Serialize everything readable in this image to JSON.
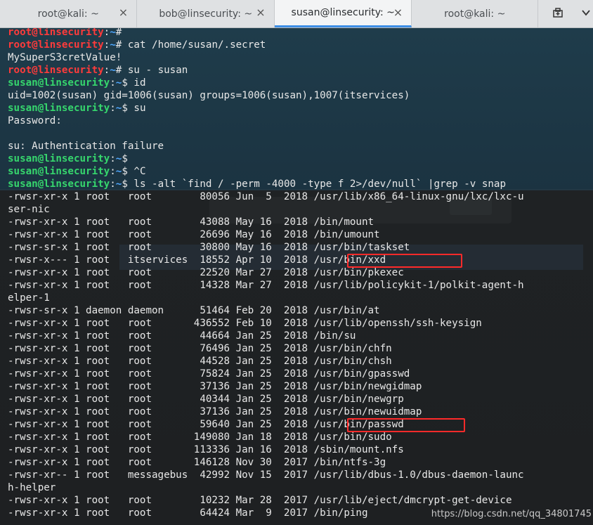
{
  "tabs": [
    {
      "label": "root@kali: ~",
      "active": false
    },
    {
      "label": "bob@linsecurity: ~",
      "active": false
    },
    {
      "label": "susan@linsecurity: ~",
      "active": true
    },
    {
      "label": "root@kali: ~",
      "active": false
    }
  ],
  "tab_actions": [
    {
      "name": "new-tab-icon",
      "glyph": "🖶"
    },
    {
      "name": "tabs-menu-icon",
      "glyph": "⌄"
    }
  ],
  "colors": {
    "accent": "#3d8ee6",
    "root_prompt": "#ff3b3b",
    "user_prompt": "#36d66d",
    "path": "#4fa8ff",
    "highlight": "#ff2a2a"
  },
  "terminal": {
    "prompt_lines": [
      {
        "user": "root@linsecurity",
        "path": "~",
        "symbol": "# ",
        "cmd": ""
      },
      {
        "user": "root@linsecurity",
        "path": "~",
        "symbol": "# ",
        "cmd": "cat /home/susan/.secret"
      },
      {
        "text": "MySuperS3cretValue!"
      },
      {
        "user": "root@linsecurity",
        "path": "~",
        "symbol": "# ",
        "cmd": "su - susan"
      },
      {
        "user": "susan@linsecurity",
        "path": "~",
        "symbol": "$ ",
        "cmd": "id"
      },
      {
        "text": "uid=1002(susan) gid=1006(susan) groups=1006(susan),1007(itservices)"
      },
      {
        "user": "susan@linsecurity",
        "path": "~",
        "symbol": "$ ",
        "cmd": "su"
      },
      {
        "text": "Password: "
      },
      {
        "text": ""
      },
      {
        "text": "su: Authentication failure"
      },
      {
        "user": "susan@linsecurity",
        "path": "~",
        "symbol": "$ ",
        "cmd": ""
      },
      {
        "user": "susan@linsecurity",
        "path": "~",
        "symbol": "$ ",
        "cmd": "^C"
      },
      {
        "user": "susan@linsecurity",
        "path": "~",
        "symbol": "$ ",
        "cmd": "ls -alt `find / -perm -4000 -type f 2>/dev/null` |grep -v snap"
      },
      {
        "text": "-rwsr-xr-x 1 root   root        80056 Jun  5  2018 /usr/lib/x86_64-linux-gnu/lxc/lxc-u"
      },
      {
        "text": "ser-nic"
      },
      {
        "text": "-rwsr-xr-x 1 root   root        43088 May 16  2018 /bin/mount"
      },
      {
        "text": "-rwsr-xr-x 1 root   root        26696 May 16  2018 /bin/umount"
      },
      {
        "text": "-rwsr-sr-x 1 root   root        30800 May 16  2018 /usr/bin/taskset"
      },
      {
        "text": "-rwsr-x--- 1 root   itservices  18552 Apr 10  2018 /usr/bin/xxd"
      },
      {
        "text": "-rwsr-xr-x 1 root   root        22520 Mar 27  2018 /usr/bin/pkexec"
      },
      {
        "text": "-rwsr-xr-x 1 root   root        14328 Mar 27  2018 /usr/lib/policykit-1/polkit-agent-h"
      },
      {
        "text": "elper-1"
      },
      {
        "text": "-rwsr-sr-x 1 daemon daemon      51464 Feb 20  2018 /usr/bin/at"
      },
      {
        "text": "-rwsr-xr-x 1 root   root       436552 Feb 10  2018 /usr/lib/openssh/ssh-keysign"
      },
      {
        "text": "-rwsr-xr-x 1 root   root        44664 Jan 25  2018 /bin/su"
      },
      {
        "text": "-rwsr-xr-x 1 root   root        76496 Jan 25  2018 /usr/bin/chfn"
      },
      {
        "text": "-rwsr-xr-x 1 root   root        44528 Jan 25  2018 /usr/bin/chsh"
      },
      {
        "text": "-rwsr-xr-x 1 root   root        75824 Jan 25  2018 /usr/bin/gpasswd"
      },
      {
        "text": "-rwsr-xr-x 1 root   root        37136 Jan 25  2018 /usr/bin/newgidmap"
      },
      {
        "text": "-rwsr-xr-x 1 root   root        40344 Jan 25  2018 /usr/bin/newgrp"
      },
      {
        "text": "-rwsr-xr-x 1 root   root        37136 Jan 25  2018 /usr/bin/newuidmap"
      },
      {
        "text": "-rwsr-xr-x 1 root   root        59640 Jan 25  2018 /usr/bin/passwd"
      },
      {
        "text": "-rwsr-xr-x 1 root   root       149080 Jan 18  2018 /usr/bin/sudo"
      },
      {
        "text": "-rwsr-xr-x 1 root   root       113336 Jan 16  2018 /sbin/mount.nfs"
      },
      {
        "text": "-rwsr-xr-x 1 root   root       146128 Nov 30  2017 /bin/ntfs-3g"
      },
      {
        "text": "-rwsr-xr-- 1 root   messagebus  42992 Nov 15  2017 /usr/lib/dbus-1.0/dbus-daemon-launc"
      },
      {
        "text": "h-helper"
      },
      {
        "text": "-rwsr-xr-x 1 root   root        10232 Mar 28  2017 /usr/lib/eject/dmcrypt-get-device"
      },
      {
        "text": "-rwsr-xr-x 1 root   root        64424 Mar  9  2017 /bin/ping"
      }
    ]
  },
  "watermark": "https://blog.csdn.net/qq_34801745"
}
